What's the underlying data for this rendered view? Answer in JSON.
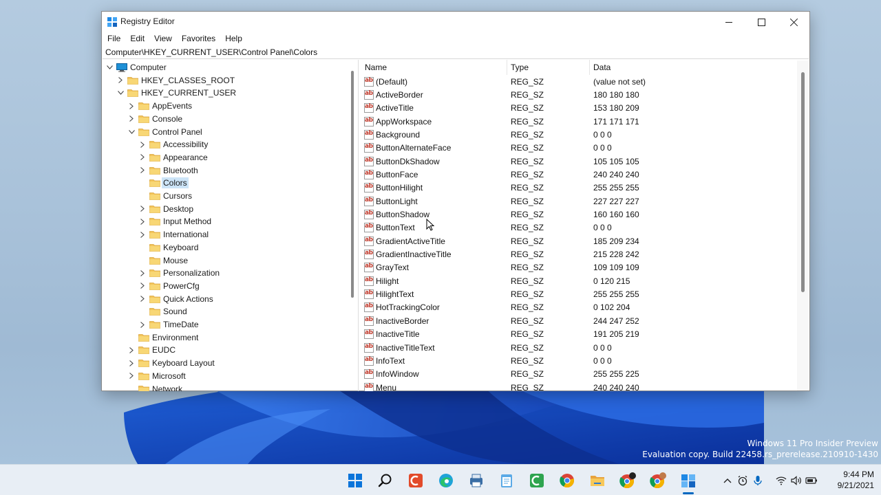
{
  "window": {
    "title": "Registry Editor",
    "app_icon": "regedit-icon"
  },
  "menu": [
    "File",
    "Edit",
    "View",
    "Favorites",
    "Help"
  ],
  "address": "Computer\\HKEY_CURRENT_USER\\Control Panel\\Colors",
  "tree": [
    {
      "label": "Computer",
      "level": 0,
      "state": "expanded",
      "icon": "computer-icon"
    },
    {
      "label": "HKEY_CLASSES_ROOT",
      "level": 1,
      "state": "collapsed"
    },
    {
      "label": "HKEY_CURRENT_USER",
      "level": 1,
      "state": "expanded"
    },
    {
      "label": "AppEvents",
      "level": 2,
      "state": "collapsed"
    },
    {
      "label": "Console",
      "level": 2,
      "state": "collapsed"
    },
    {
      "label": "Control Panel",
      "level": 2,
      "state": "expanded"
    },
    {
      "label": "Accessibility",
      "level": 3,
      "state": "collapsed"
    },
    {
      "label": "Appearance",
      "level": 3,
      "state": "collapsed"
    },
    {
      "label": "Bluetooth",
      "level": 3,
      "state": "collapsed"
    },
    {
      "label": "Colors",
      "level": 3,
      "state": "leaf",
      "selected": true
    },
    {
      "label": "Cursors",
      "level": 3,
      "state": "leaf"
    },
    {
      "label": "Desktop",
      "level": 3,
      "state": "collapsed"
    },
    {
      "label": "Input Method",
      "level": 3,
      "state": "collapsed"
    },
    {
      "label": "International",
      "level": 3,
      "state": "collapsed"
    },
    {
      "label": "Keyboard",
      "level": 3,
      "state": "leaf"
    },
    {
      "label": "Mouse",
      "level": 3,
      "state": "leaf"
    },
    {
      "label": "Personalization",
      "level": 3,
      "state": "collapsed"
    },
    {
      "label": "PowerCfg",
      "level": 3,
      "state": "collapsed"
    },
    {
      "label": "Quick Actions",
      "level": 3,
      "state": "collapsed"
    },
    {
      "label": "Sound",
      "level": 3,
      "state": "leaf"
    },
    {
      "label": "TimeDate",
      "level": 3,
      "state": "collapsed"
    },
    {
      "label": "Environment",
      "level": 2,
      "state": "leaf"
    },
    {
      "label": "EUDC",
      "level": 2,
      "state": "collapsed"
    },
    {
      "label": "Keyboard Layout",
      "level": 2,
      "state": "collapsed"
    },
    {
      "label": "Microsoft",
      "level": 2,
      "state": "collapsed"
    },
    {
      "label": "Network",
      "level": 2,
      "state": "leaf"
    }
  ],
  "columns": [
    "Name",
    "Type",
    "Data"
  ],
  "values": [
    {
      "name": "(Default)",
      "type": "REG_SZ",
      "data": "(value not set)"
    },
    {
      "name": "ActiveBorder",
      "type": "REG_SZ",
      "data": "180 180 180"
    },
    {
      "name": "ActiveTitle",
      "type": "REG_SZ",
      "data": "153 180 209"
    },
    {
      "name": "AppWorkspace",
      "type": "REG_SZ",
      "data": "171 171 171"
    },
    {
      "name": "Background",
      "type": "REG_SZ",
      "data": "0 0 0"
    },
    {
      "name": "ButtonAlternateFace",
      "type": "REG_SZ",
      "data": "0 0 0"
    },
    {
      "name": "ButtonDkShadow",
      "type": "REG_SZ",
      "data": "105 105 105"
    },
    {
      "name": "ButtonFace",
      "type": "REG_SZ",
      "data": "240 240 240"
    },
    {
      "name": "ButtonHilight",
      "type": "REG_SZ",
      "data": "255 255 255"
    },
    {
      "name": "ButtonLight",
      "type": "REG_SZ",
      "data": "227 227 227"
    },
    {
      "name": "ButtonShadow",
      "type": "REG_SZ",
      "data": "160 160 160"
    },
    {
      "name": "ButtonText",
      "type": "REG_SZ",
      "data": "0 0 0"
    },
    {
      "name": "GradientActiveTitle",
      "type": "REG_SZ",
      "data": "185 209 234"
    },
    {
      "name": "GradientInactiveTitle",
      "type": "REG_SZ",
      "data": "215 228 242"
    },
    {
      "name": "GrayText",
      "type": "REG_SZ",
      "data": "109 109 109"
    },
    {
      "name": "Hilight",
      "type": "REG_SZ",
      "data": "0 120 215"
    },
    {
      "name": "HilightText",
      "type": "REG_SZ",
      "data": "255 255 255"
    },
    {
      "name": "HotTrackingColor",
      "type": "REG_SZ",
      "data": "0 102 204"
    },
    {
      "name": "InactiveBorder",
      "type": "REG_SZ",
      "data": "244 247 252"
    },
    {
      "name": "InactiveTitle",
      "type": "REG_SZ",
      "data": "191 205 219"
    },
    {
      "name": "InactiveTitleText",
      "type": "REG_SZ",
      "data": "0 0 0"
    },
    {
      "name": "InfoText",
      "type": "REG_SZ",
      "data": "0 0 0"
    },
    {
      "name": "InfoWindow",
      "type": "REG_SZ",
      "data": "255 255 225"
    },
    {
      "name": "Menu",
      "type": "REG_SZ",
      "data": "240 240 240"
    }
  ],
  "watermark": {
    "line1": "Windows 11 Pro Insider Preview",
    "line2": "Evaluation copy. Build 22458.rs_prerelease.210910-1430"
  },
  "taskbar": {
    "apps": [
      "start-icon",
      "search-icon",
      "app-red-icon",
      "edge-icon",
      "app-printer-icon",
      "notepad-icon",
      "app-green-icon",
      "chrome-icon",
      "file-explorer-icon",
      "chrome-profile-icon",
      "chrome-profile-2-icon",
      "regedit-icon"
    ],
    "tray": [
      "chevron-up-icon",
      "alarm-icon",
      "microphone-icon",
      "wifi-icon",
      "speaker-icon",
      "battery-icon"
    ],
    "time": "9:44 PM",
    "date": "9/21/2021"
  },
  "colors": {
    "selection": "#cce4f7",
    "folder": "#f3c55b",
    "accent": "#0067c0"
  }
}
